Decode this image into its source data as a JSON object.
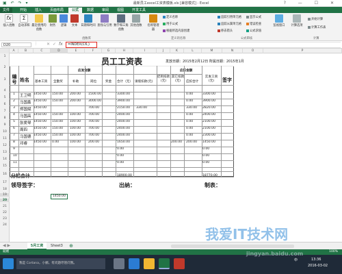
{
  "window": {
    "title": "最新员工excel工资表模板.xls [兼容模式] - Excel",
    "controls": [
      "?",
      "—",
      "☐",
      "✕"
    ]
  },
  "ribbon_tabs": [
    "文件",
    "开始",
    "插入",
    "页面布局",
    "公式",
    "数据",
    "审阅",
    "视图",
    "开发工具"
  ],
  "ribbon": {
    "insert_function": "插入函数",
    "autosum": "自动求和",
    "recent": "最近使用的函数",
    "financial": "财务",
    "logical": "逻辑",
    "text": "文本",
    "datetime": "日期和时间",
    "lookup": "查找与引用",
    "math": "数学和三角函数",
    "other": "其他函数",
    "name_manager": "名称管理器",
    "define_name": "定义名称",
    "use_in_formula": "用于公式",
    "create_from_sel": "根据所选内容创建",
    "trace_precedents": "追踪引用单元格",
    "trace_dependents": "追踪从属单元格",
    "remove_arrows": "移去箭头",
    "show_formulas": "显示公式",
    "error_check": "错误检查",
    "evaluate": "公式求值",
    "watch": "监视窗口",
    "calc_options": "计算选项",
    "calc_now": "开始计算",
    "calc_sheet": "计算工作表",
    "group_library": "函数库",
    "group_names": "定义的名称",
    "group_audit": "公式审核",
    "group_calc": "计算"
  },
  "formula_bar": {
    "name_box": "D20",
    "fx": "fx",
    "formula": "=INDEX(C6,)"
  },
  "columns": [
    "A",
    "B",
    "C",
    "D",
    "E",
    "F",
    "G",
    "H",
    "I",
    "J",
    "K",
    "L",
    "M",
    "N",
    "O",
    "P"
  ],
  "rows": [
    "1",
    "2",
    "3",
    "4",
    "5",
    "6",
    "7",
    "8",
    "9",
    "10",
    "11",
    "12",
    "13",
    "14",
    "15",
    "16",
    "17",
    "18",
    "19",
    "20",
    "21",
    "22",
    "23",
    "24"
  ],
  "sheet_content": {
    "title": "员工工资表",
    "issue_date": "发放日期：2015年2月12日 所属日期：2015年1月",
    "col_num": "编号",
    "col_name": "姓名",
    "group_pay": "应发金额",
    "group_deduct": "应扣金额",
    "col_base": "基本工资",
    "col_perf": "全勤奖",
    "col_subsidy": "补助",
    "col_bonus2": "岗位",
    "col_bonus": "奖金",
    "col_total": "合计（元）",
    "col_leave": "请假扣款(元)",
    "col_late": "迟到扣款(元)",
    "col_social": "其它扣款(元)",
    "col_dtotal": "应扣合计",
    "col_net": "实发工资(元)",
    "col_sign": "签字",
    "subtotal": "分栏合计",
    "leader_sign": "领导签字：",
    "cashier": "出纳：",
    "maker": "制表："
  },
  "employees": [
    {
      "no": "1",
      "name": "王卫明",
      "base": "1450.00",
      "perf": "150.00",
      "subsidy": "200.00",
      "post": "1500.00",
      "total": "3300.00",
      "leave": "",
      "late": "",
      "dtotal": "0.00",
      "net": "3300.00"
    },
    {
      "no": "2",
      "name": "马国鑫",
      "base": "1450.00",
      "perf": "150.00",
      "subsidy": "200.00",
      "post": "3000.00",
      "total": "3900.00",
      "leave": "",
      "late": "",
      "dtotal": "0.00",
      "net": "3900.00"
    },
    {
      "no": "3",
      "name": "郑国斌",
      "base": "1450.00",
      "perf": "",
      "subsidy": "",
      "post": "700.00",
      "total": "2150.00",
      "leave": "330.00",
      "late": "",
      "dtotal": "330.00",
      "net": "2820.00"
    },
    {
      "no": "4",
      "name": "马国高",
      "base": "1450.00",
      "perf": "150.00",
      "subsidy": "100.00",
      "post": "700.00",
      "total": "2400.00",
      "leave": "",
      "late": "",
      "dtotal": "0.00",
      "net": "2400.00"
    },
    {
      "no": "5",
      "name": "张爱琴",
      "base": "1450.00",
      "perf": "150.00",
      "subsidy": "100.00",
      "post": "700.00",
      "total": "2400.00",
      "leave": "",
      "late": "",
      "dtotal": "0.00",
      "net": "2100.00"
    },
    {
      "no": "6",
      "name": "周四",
      "base": "1450.00",
      "perf": "150.00",
      "subsidy": "100.00",
      "post": "700.00",
      "total": "2400.00",
      "leave": "",
      "late": "",
      "dtotal": "0.00",
      "net": "2100.00"
    },
    {
      "no": "7",
      "name": "马国德",
      "base": "1450.00",
      "perf": "150.00",
      "subsidy": "100.00",
      "post": "700.00",
      "total": "2400.00",
      "leave": "",
      "late": "",
      "dtotal": "0.00",
      "net": "2300.00"
    },
    {
      "no": "8",
      "name": "邓睿",
      "base": "1450.00",
      "perf": "0.00",
      "subsidy": "100.00",
      "post": "200.00",
      "total": "1650.00",
      "leave": "",
      "late": "200.00",
      "dtotal": "200.00",
      "net": "1450.00"
    },
    {
      "no": "9",
      "name": "",
      "base": "",
      "perf": "",
      "subsidy": "",
      "post": "",
      "total": "0.00",
      "leave": "",
      "late": "",
      "dtotal": "",
      "net": "0.00"
    },
    {
      "no": "10",
      "name": "",
      "base": "",
      "perf": "",
      "subsidy": "",
      "post": "",
      "total": "0.00",
      "leave": "",
      "late": "",
      "dtotal": "",
      "net": "0.00"
    },
    {
      "no": "11",
      "name": "",
      "base": "",
      "perf": "",
      "subsidy": "",
      "post": "",
      "total": "0.00",
      "leave": "",
      "late": "",
      "dtotal": "",
      "net": "0.00"
    }
  ],
  "sum_total": "18900.00",
  "sum_net": "18770.00",
  "selected_cell_value": "1450.00",
  "sheets": [
    "5月工资",
    "Sheet3"
  ],
  "add_sheet": "⊕",
  "status": {
    "ready": "就绪",
    "zoom": "100%"
  },
  "taskbar": {
    "search": "我是 Cortana，小娜。有问题尽管问我。",
    "time": "13:36",
    "date": "2016-03-02",
    "lang": "中"
  },
  "watermark": {
    "line1": "我爱IT技术网",
    "line2": "jingyan.baidu.com"
  },
  "colors": {
    "excel_green": "#217346",
    "highlight_red": "#e3231b",
    "taskbar": "#1f2a38"
  }
}
